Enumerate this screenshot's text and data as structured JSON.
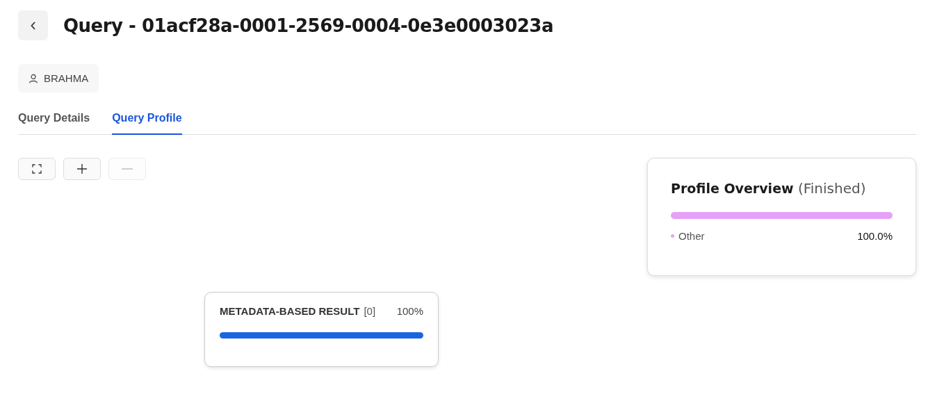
{
  "header": {
    "title": "Query - 01acf28a-0001-2569-0004-0e3e0003023a"
  },
  "user": {
    "name": "BRAHMA"
  },
  "tabs": [
    {
      "label": "Query Details",
      "selected": false
    },
    {
      "label": "Query Profile",
      "selected": true
    }
  ],
  "toolbar": [
    {
      "kind": "fit",
      "disabled": false
    },
    {
      "kind": "zoom-in",
      "disabled": false
    },
    {
      "kind": "zoom-out",
      "disabled": true
    }
  ],
  "overview": {
    "title": "Profile Overview",
    "status": "(Finished)",
    "segments": [
      {
        "name": "Other",
        "percent": "100.0%",
        "level": 1,
        "color": "#e6a1f8"
      }
    ]
  },
  "node": {
    "name": "METADATA-BASED RESULT",
    "id": "[0]",
    "percent": "100%"
  }
}
